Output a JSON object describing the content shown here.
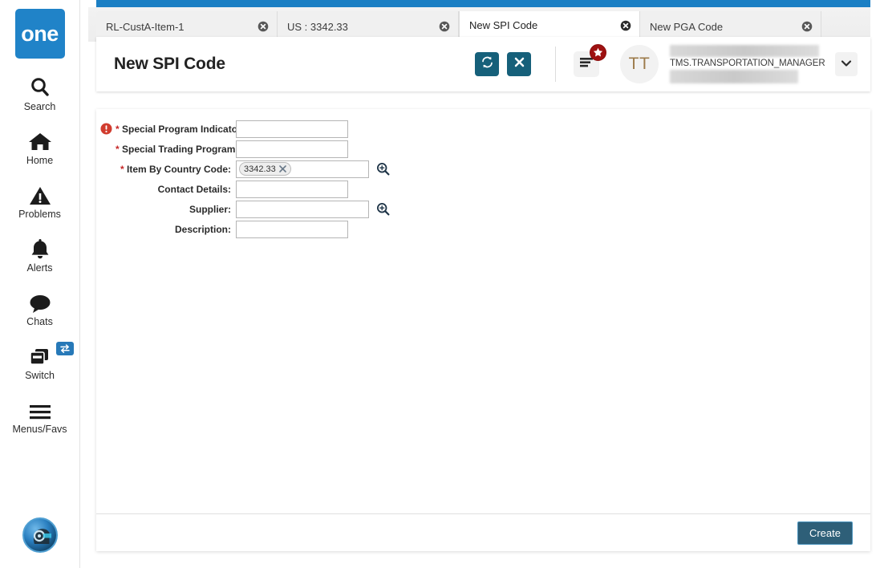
{
  "app": {
    "logo_text": "one",
    "accent_blue": "#1b7fc4",
    "accent_teal": "#16607a",
    "badge_red": "#9e1111",
    "required_red": "#c62828"
  },
  "sidebar": {
    "items": [
      {
        "label": "Search",
        "icon": "search-icon"
      },
      {
        "label": "Home",
        "icon": "home-icon"
      },
      {
        "label": "Problems",
        "icon": "warning-triangle-icon"
      },
      {
        "label": "Alerts",
        "icon": "bell-icon"
      },
      {
        "label": "Chats",
        "icon": "chat-bubble-icon"
      },
      {
        "label": "Switch",
        "icon": "switch-windows-icon",
        "badge_icon": "swap-arrows-icon"
      },
      {
        "label": "Menus/Favs",
        "icon": "hamburger-icon"
      }
    ],
    "assistant_avatar": "ai-head-avatar-icon"
  },
  "tabs": [
    {
      "label": "RL-CustA-Item-1",
      "active": false
    },
    {
      "label": "US : 3342.33",
      "active": false
    },
    {
      "label": "New SPI Code",
      "active": true
    },
    {
      "label": "New PGA Code",
      "active": false
    }
  ],
  "header": {
    "title": "New SPI Code",
    "refresh_icon": "refresh-icon",
    "close_icon": "close-x-icon",
    "menu_icon": "menu-lines-icon",
    "menu_badge_icon": "star-icon",
    "avatar_initials": "TT",
    "user_name": "TMS.TRANSPORTATION_MANAGER",
    "chevron_icon": "chevron-down-icon"
  },
  "form": {
    "fields": [
      {
        "label": "Special Program Indicator:",
        "required": true,
        "has_error": true,
        "error_icon": "error-exclamation-icon",
        "type": "text",
        "value": "",
        "placeholder": "",
        "width": "small"
      },
      {
        "label": "Special Trading Program:",
        "required": true,
        "has_error": false,
        "type": "text",
        "value": "",
        "placeholder": "",
        "width": "small"
      },
      {
        "label": "Item By Country Code:",
        "required": true,
        "has_error": false,
        "type": "picker",
        "chip_value": "3342.33",
        "chip_remove_icon": "chip-remove-x-icon",
        "picker_icon": "magnifier-plus-icon",
        "width": "large"
      },
      {
        "label": "Contact Details:",
        "required": false,
        "has_error": false,
        "type": "text",
        "value": "",
        "placeholder": "",
        "width": "small"
      },
      {
        "label": "Supplier:",
        "required": false,
        "has_error": false,
        "type": "picker",
        "chip_value": "",
        "picker_icon": "magnifier-plus-icon",
        "width": "large"
      },
      {
        "label": "Description:",
        "required": false,
        "has_error": false,
        "type": "text",
        "value": "",
        "placeholder": "",
        "width": "small"
      }
    ]
  },
  "footer": {
    "create_label": "Create"
  }
}
